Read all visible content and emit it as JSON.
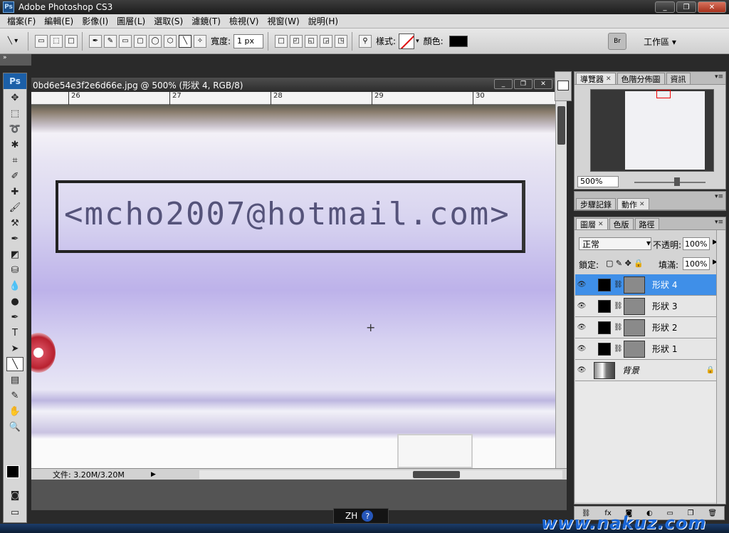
{
  "app": {
    "title": "Adobe Photoshop CS3",
    "badge": "Ps"
  },
  "window_controls": {
    "minimize": "_",
    "restore": "❐",
    "close": "✕"
  },
  "menu": [
    {
      "label": "檔案(F)"
    },
    {
      "label": "編輯(E)"
    },
    {
      "label": "影像(I)"
    },
    {
      "label": "圖層(L)"
    },
    {
      "label": "選取(S)"
    },
    {
      "label": "濾鏡(T)"
    },
    {
      "label": "檢視(V)"
    },
    {
      "label": "視窗(W)"
    },
    {
      "label": "說明(H)"
    }
  ],
  "options": {
    "width_label": "寬度:",
    "width_value": "1 px",
    "style_label": "樣式:",
    "color_label": "顏色:",
    "workspace_label": "工作區 ▾",
    "bridge_label": "Br"
  },
  "document": {
    "title": "0bd6e54e3f2e6d66e.jpg @ 500% (形狀 4, RGB/8)",
    "ruler_ticks": [
      "26",
      "27",
      "28",
      "29",
      "30"
    ],
    "email_text": "<mcho2007@hotmail.com>",
    "status": "文件: 3.20M/3.20M"
  },
  "navigator_panel": {
    "tabs": [
      "導覽器",
      "色階分佈圖",
      "資訊"
    ],
    "zoom": "500%"
  },
  "history_panel": {
    "tabs": [
      "步驟記錄",
      "動作"
    ]
  },
  "layers_panel": {
    "tabs": [
      "圖層",
      "色版",
      "路徑"
    ],
    "blend_mode": "正常",
    "opacity_label": "不透明:",
    "opacity_value": "100%",
    "lock_label": "鎖定:",
    "fill_label": "填滿:",
    "fill_value": "100%",
    "layers": [
      {
        "name": "形狀 4",
        "selected": true
      },
      {
        "name": "形狀 3",
        "selected": false
      },
      {
        "name": "形狀 2",
        "selected": false
      },
      {
        "name": "形狀 1",
        "selected": false
      }
    ],
    "background_layer": "背景"
  },
  "ime": {
    "label": "ZH",
    "help": "?"
  },
  "watermark": "www.nakuz.com",
  "colors": {
    "selection": "#3f8fe8",
    "accent_blue": "#1b5fa8"
  }
}
